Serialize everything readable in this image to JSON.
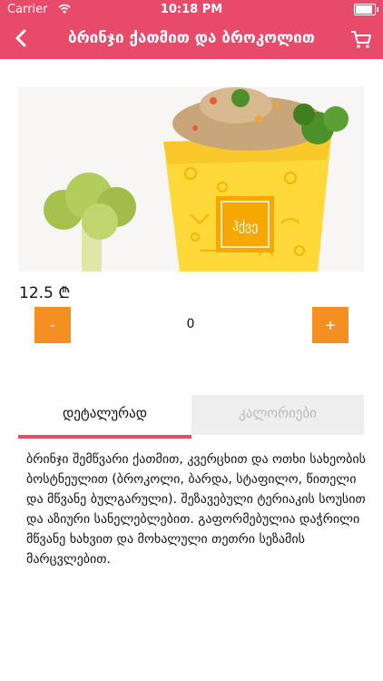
{
  "status_bar": {
    "carrier": "Carrier",
    "time": "10:18 PM",
    "battery_level": 0.9
  },
  "header": {
    "title": "ბრინჯი ქათმით და ბროკოლით",
    "back_icon": "chevron-left-icon",
    "cart_icon": "cart-icon"
  },
  "product": {
    "price": "12.5 ₾",
    "quantity": {
      "minus_label": "-",
      "value": "0",
      "plus_label": "+"
    },
    "box_brand": "ჰქვე",
    "accent_color": "#e84a6a",
    "button_color": "#f39021"
  },
  "tabs": [
    {
      "label": "დეტალურად",
      "active": true
    },
    {
      "label": "კალორიები",
      "active": false
    }
  ],
  "description": "ბრინჯი შემწვარი ქათმით, კვერცხით და ოთხი სახეობის ბოსტნეულით (ბროკოლი, ბარდა, სტაფილო, წითელი და მწვანე ბულგარული). შეზავებული ტერიაკის სოუსით და აზიური სანელებლებით. გაფორმებულია დაჭრილი მწვანე ხახვით და მოხალული თეთრი სეზამის მარცვლებით."
}
